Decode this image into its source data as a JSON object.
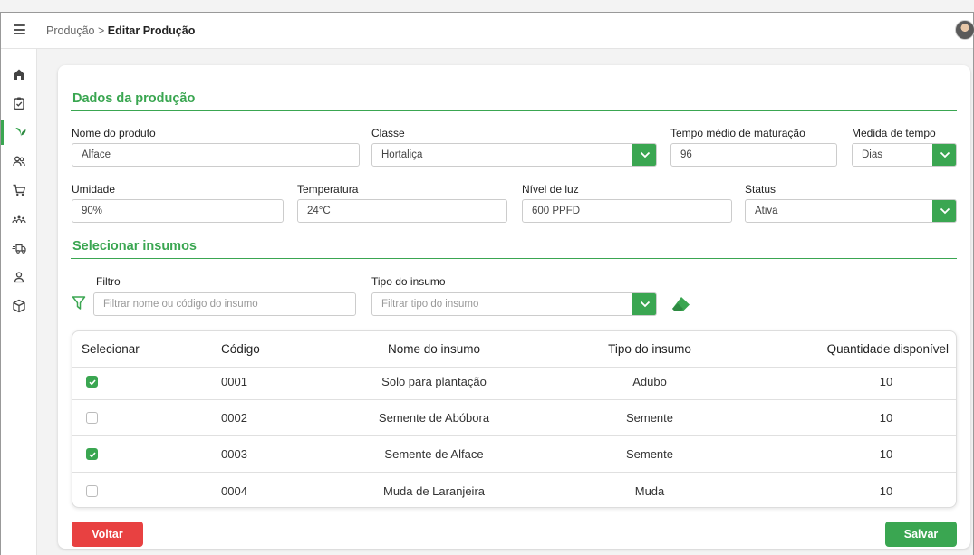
{
  "breadcrumb": {
    "parent": "Produção",
    "separator": ">",
    "current": "Editar Produção"
  },
  "sidebar": {
    "items": [
      "home-icon",
      "clipboard-check-icon",
      "plant-icon",
      "users-icon",
      "cart-icon",
      "team-icon",
      "truck-icon",
      "user-icon",
      "box-icon"
    ],
    "active_index": 2
  },
  "dados": {
    "title": "Dados da produção",
    "nome_label": "Nome do produto",
    "nome_value": "Alface",
    "classe_label": "Classe",
    "classe_value": "Hortaliça",
    "tempo_label": "Tempo médio de maturação",
    "tempo_value": "96",
    "medida_label": "Medida de tempo",
    "medida_value": "Dias",
    "umidade_label": "Umidade",
    "umidade_value": "90%",
    "temperatura_label": "Temperatura",
    "temperatura_value": "24°C",
    "luz_label": "Nível de luz",
    "luz_value": "600 PPFD",
    "status_label": "Status",
    "status_value": "Ativa"
  },
  "insumos": {
    "title": "Selecionar insumos",
    "filtro_label": "Filtro",
    "filtro_placeholder": "Filtrar nome ou código do insumo",
    "tipo_label": "Tipo do insumo",
    "tipo_placeholder": "Filtrar tipo do insumo"
  },
  "table": {
    "headers": {
      "selecionar": "Selecionar",
      "codigo": "Código",
      "nome": "Nome do insumo",
      "tipo": "Tipo do insumo",
      "quantidade": "Quantidade disponível"
    },
    "rows": [
      {
        "selected": true,
        "codigo": "0001",
        "nome": "Solo para plantação",
        "tipo": "Adubo",
        "quantidade": "10"
      },
      {
        "selected": false,
        "codigo": "0002",
        "nome": "Semente de Abóbora",
        "tipo": "Semente",
        "quantidade": "10"
      },
      {
        "selected": true,
        "codigo": "0003",
        "nome": "Semente de Alface",
        "tipo": "Semente",
        "quantidade": "10"
      },
      {
        "selected": false,
        "codigo": "0004",
        "nome": "Muda de Laranjeira",
        "tipo": "Muda",
        "quantidade": "10"
      }
    ]
  },
  "actions": {
    "back_label": "Voltar",
    "save_label": "Salvar"
  },
  "colors": {
    "accent": "#3aa651",
    "danger": "#e84141"
  }
}
